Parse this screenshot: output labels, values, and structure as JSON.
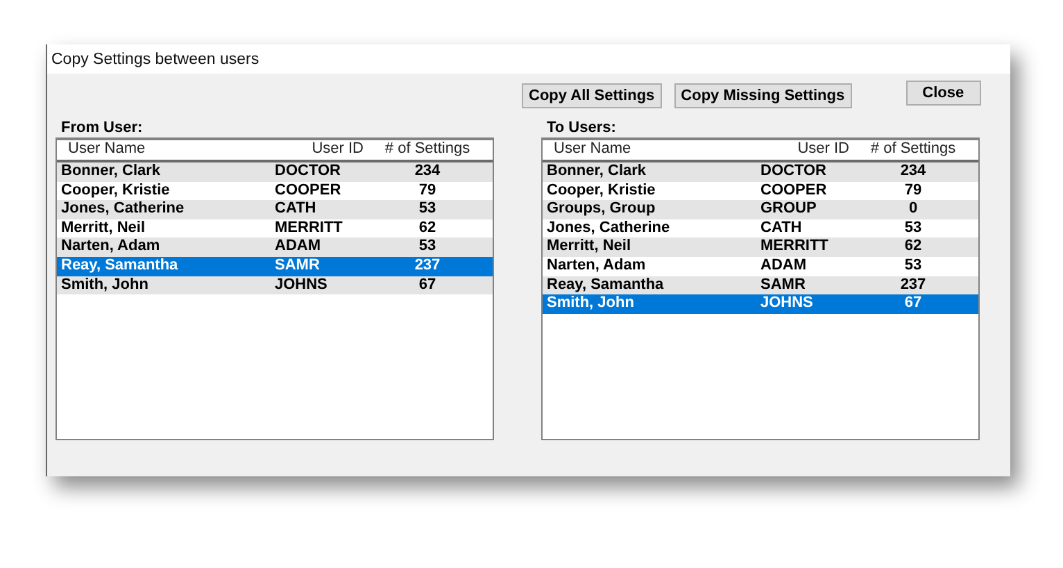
{
  "window": {
    "title": "Copy Settings between users"
  },
  "buttons": [
    {
      "label": "Copy All Settings"
    },
    {
      "label": "Copy Missing Settings"
    },
    {
      "label": "Close"
    }
  ],
  "from_list": {
    "label": "From User:",
    "columns": [
      "User Name",
      "User ID",
      "# of Settings"
    ],
    "rows": [
      {
        "name": "Bonner, Clark",
        "id": "DOCTOR",
        "count": "234",
        "selected": false
      },
      {
        "name": "Cooper, Kristie",
        "id": "COOPER",
        "count": "79",
        "selected": false
      },
      {
        "name": "Jones, Catherine",
        "id": "CATH",
        "count": "53",
        "selected": false
      },
      {
        "name": "Merritt, Neil",
        "id": "MERRITT",
        "count": "62",
        "selected": false
      },
      {
        "name": "Narten, Adam",
        "id": "ADAM",
        "count": "53",
        "selected": false
      },
      {
        "name": "Reay, Samantha",
        "id": "SAMR",
        "count": "237",
        "selected": true
      },
      {
        "name": "Smith, John",
        "id": "JOHNS",
        "count": "67",
        "selected": false
      }
    ]
  },
  "to_list": {
    "label": "To Users:",
    "columns": [
      "User Name",
      "User ID",
      "# of Settings"
    ],
    "rows": [
      {
        "name": "Bonner, Clark",
        "id": "DOCTOR",
        "count": "234",
        "selected": false
      },
      {
        "name": "Cooper, Kristie",
        "id": "COOPER",
        "count": "79",
        "selected": false
      },
      {
        "name": "Groups, Group",
        "id": "GROUP",
        "count": "0",
        "selected": false
      },
      {
        "name": "Jones, Catherine",
        "id": "CATH",
        "count": "53",
        "selected": false
      },
      {
        "name": "Merritt, Neil",
        "id": "MERRITT",
        "count": "62",
        "selected": false
      },
      {
        "name": "Narten, Adam",
        "id": "ADAM",
        "count": "53",
        "selected": false
      },
      {
        "name": "Reay, Samantha",
        "id": "SAMR",
        "count": "237",
        "selected": false
      },
      {
        "name": "Smith, John",
        "id": "JOHNS",
        "count": "67",
        "selected": true
      }
    ]
  }
}
